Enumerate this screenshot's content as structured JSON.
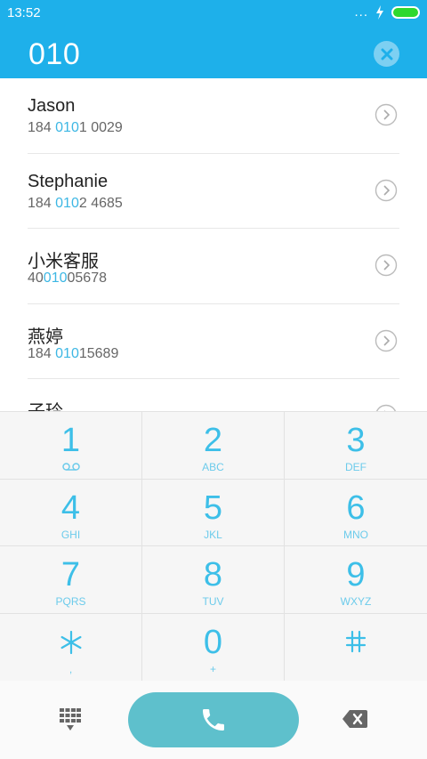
{
  "status": {
    "time": "13:52",
    "dots": "..."
  },
  "search": {
    "query": "010"
  },
  "contacts": [
    {
      "name": "Jason",
      "num_pre": "184 ",
      "num_hl": "010",
      "num_post": "1 0029"
    },
    {
      "name": "Stephanie",
      "num_pre": "184 ",
      "num_hl": "010",
      "num_post": "2 4685"
    },
    {
      "name": "小米客服",
      "num_pre": "40",
      "num_hl": "010",
      "num_post": "05678"
    },
    {
      "name": "燕婷",
      "num_pre": "184 ",
      "num_hl": "010",
      "num_post": "15689"
    },
    {
      "name": "子玲",
      "num_pre": "",
      "num_hl": "",
      "num_post": ""
    }
  ],
  "keypad": {
    "k1": {
      "digit": "1",
      "letters": ""
    },
    "k2": {
      "digit": "2",
      "letters": "ABC"
    },
    "k3": {
      "digit": "3",
      "letters": "DEF"
    },
    "k4": {
      "digit": "4",
      "letters": "GHI"
    },
    "k5": {
      "digit": "5",
      "letters": "JKL"
    },
    "k6": {
      "digit": "6",
      "letters": "MNO"
    },
    "k7": {
      "digit": "7",
      "letters": "PQRS"
    },
    "k8": {
      "digit": "8",
      "letters": "TUV"
    },
    "k9": {
      "digit": "9",
      "letters": "WXYZ"
    },
    "kstar": {
      "digit": "",
      "letters": ","
    },
    "k0": {
      "digit": "0",
      "letters": "+"
    },
    "khash": {
      "digit": "",
      "letters": ""
    }
  },
  "icons": {
    "voicemail": "voicemail-icon",
    "star": "asterisk-icon",
    "hash": "hash-icon",
    "dialpad": "dialpad-icon",
    "call": "phone-icon",
    "backspace": "backspace-icon",
    "clear": "clear-icon"
  },
  "colors": {
    "accent": "#1eb0ea",
    "digit": "#3dbfe8",
    "call": "#5ec0cc",
    "highlight": "#3db7e4"
  }
}
